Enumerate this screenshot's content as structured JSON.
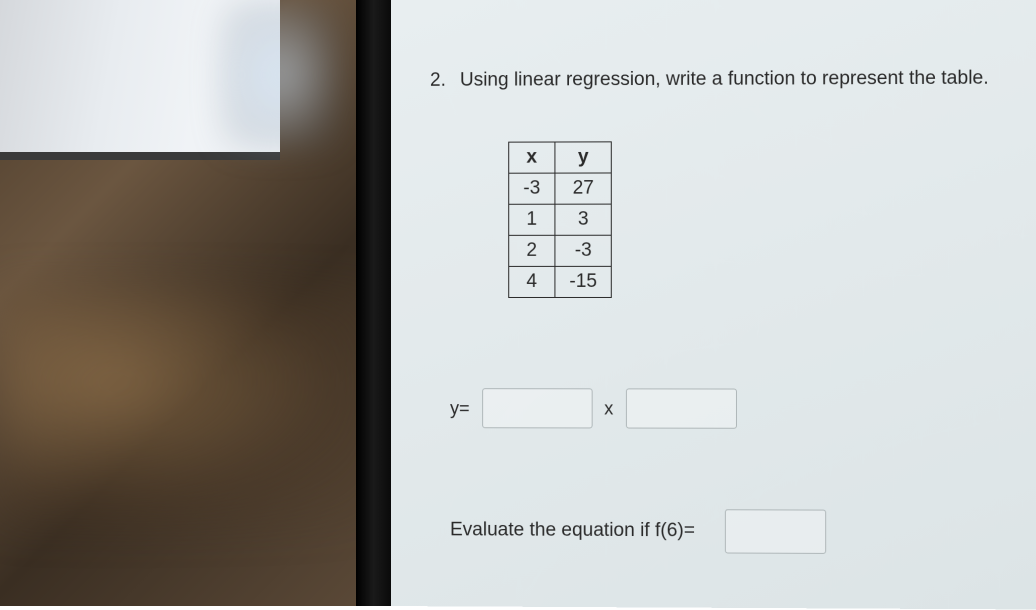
{
  "question": {
    "number": "2.",
    "text": "Using linear regression, write a function to represent the table."
  },
  "table": {
    "headers": {
      "x": "x",
      "y": "y"
    },
    "rows": [
      {
        "x": "-3",
        "y": "27"
      },
      {
        "x": "1",
        "y": "3"
      },
      {
        "x": "2",
        "y": "-3"
      },
      {
        "x": "4",
        "y": "-15"
      }
    ]
  },
  "answer": {
    "prefix": "y=",
    "separator": "x",
    "slope_value": "",
    "intercept_value": ""
  },
  "evaluate": {
    "prompt": "Evaluate the equation if f(6)=",
    "value": ""
  }
}
